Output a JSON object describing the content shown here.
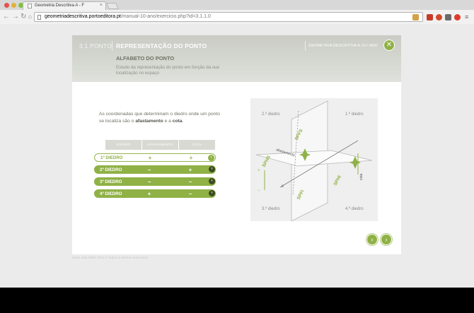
{
  "browser": {
    "tab_title": "Geometria Descritiva A - F",
    "url_host": "geometriadescritiva.portoeditora.pt",
    "url_path": "/manual-10-ano/exercicio.php?id=3.1.1.0"
  },
  "header": {
    "section": "3.1 PONTO",
    "title": "REPRESENTAÇÃO DO PONTO",
    "subtitle": "ALFABETO DO PONTO",
    "description": "Estudo da representação do ponto em função da sua localização no espaço",
    "course": "GEOMETRIA DESCRITIVA A 10.º ANO"
  },
  "intro": {
    "text": "As coordenadas que determinam o diedro onde um ponto se localiza são o ",
    "term1": "afastamento",
    "joiner": " e a ",
    "term2": "cota",
    "end": "."
  },
  "table": {
    "headers": [
      "DIEDRO",
      "AFASTAMENTO",
      "COTA"
    ],
    "rows": [
      {
        "label": "1º DIEDRO",
        "afastamento": "+",
        "cota": "+",
        "selected": true
      },
      {
        "label": "2º DIEDRO",
        "afastamento": "−",
        "cota": "+",
        "selected": false
      },
      {
        "label": "3º DIEDRO",
        "afastamento": "−",
        "cota": "−",
        "selected": false
      },
      {
        "label": "4º DIEDRO",
        "afastamento": "+",
        "cota": "−",
        "selected": false
      }
    ]
  },
  "diagram": {
    "q2": "2.º diedro",
    "q1": "1.º diedro",
    "q3": "3.º diedro",
    "q4": "4.º diedro",
    "spfs": "SPFS",
    "sphs": "SPHS",
    "sphi": "SPHI",
    "spfi": "SPFI",
    "afastamento": "afastamento",
    "cota": "cota",
    "x": "x",
    "plus": "+",
    "minus": "−"
  },
  "footer": "Maria João Müller 2011 © Todos os direitos reservados",
  "colors": {
    "accent": "#8fb146",
    "dark_accent": "#3d4a22",
    "header_bg": "#d1d3cc"
  }
}
